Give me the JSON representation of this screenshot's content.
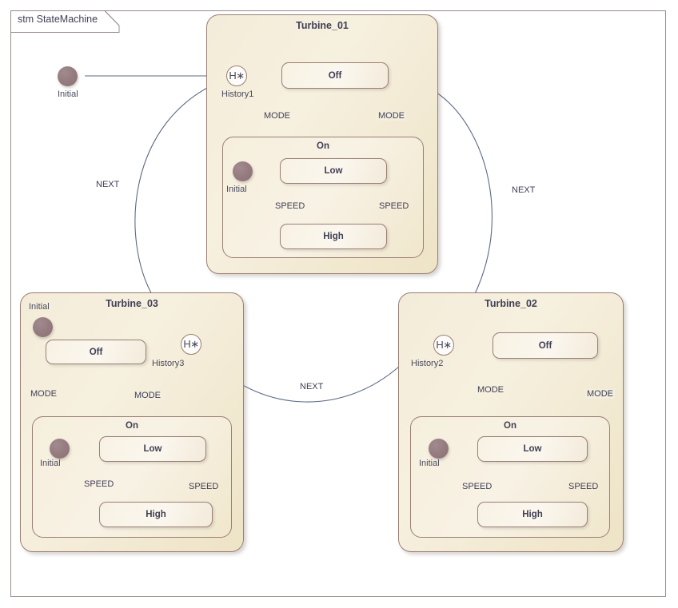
{
  "frame": {
    "label": "stm StateMachine"
  },
  "palette": {
    "frame_border": "#9c8b8b",
    "node_border": "#9a7f74",
    "composite_fill": "#f3ebd7",
    "state_fill": "#f9f4e8",
    "initial_fill": "#93787c",
    "line": "#5b6a85",
    "text": "#3f3f55"
  },
  "top_level": {
    "initial": {
      "name": "initial-node",
      "label": "Initial"
    }
  },
  "composites": [
    {
      "id": "turbine-01",
      "title": "Turbine_01",
      "history": {
        "label": "History1",
        "glyph": "H∗"
      },
      "off_state": "Off",
      "region": {
        "title": "On",
        "initial_label": "Initial",
        "low_state": "Low",
        "high_state": "High",
        "speed_down": "SPEED",
        "speed_up": "SPEED"
      },
      "mode_down": "MODE",
      "mode_up": "MODE"
    },
    {
      "id": "turbine-03",
      "title": "Turbine_03",
      "history": {
        "label": "History3",
        "glyph": "H∗"
      },
      "initial_label": "Initial",
      "off_state": "Off",
      "region": {
        "title": "On",
        "initial_label": "Initial",
        "low_state": "Low",
        "high_state": "High",
        "speed_down": "SPEED",
        "speed_up": "SPEED"
      },
      "mode_down": "MODE",
      "mode_up": "MODE"
    },
    {
      "id": "turbine-02",
      "title": "Turbine_02",
      "history": {
        "label": "History2",
        "glyph": "H∗"
      },
      "off_state": "Off",
      "region": {
        "title": "On",
        "initial_label": "Initial",
        "low_state": "Low",
        "high_state": "High",
        "speed_down": "SPEED",
        "speed_up": "SPEED"
      },
      "mode_down": "MODE",
      "mode_up": "MODE"
    }
  ],
  "transitions": {
    "next_left": "NEXT",
    "next_right": "NEXT",
    "next_bottom": "NEXT"
  }
}
